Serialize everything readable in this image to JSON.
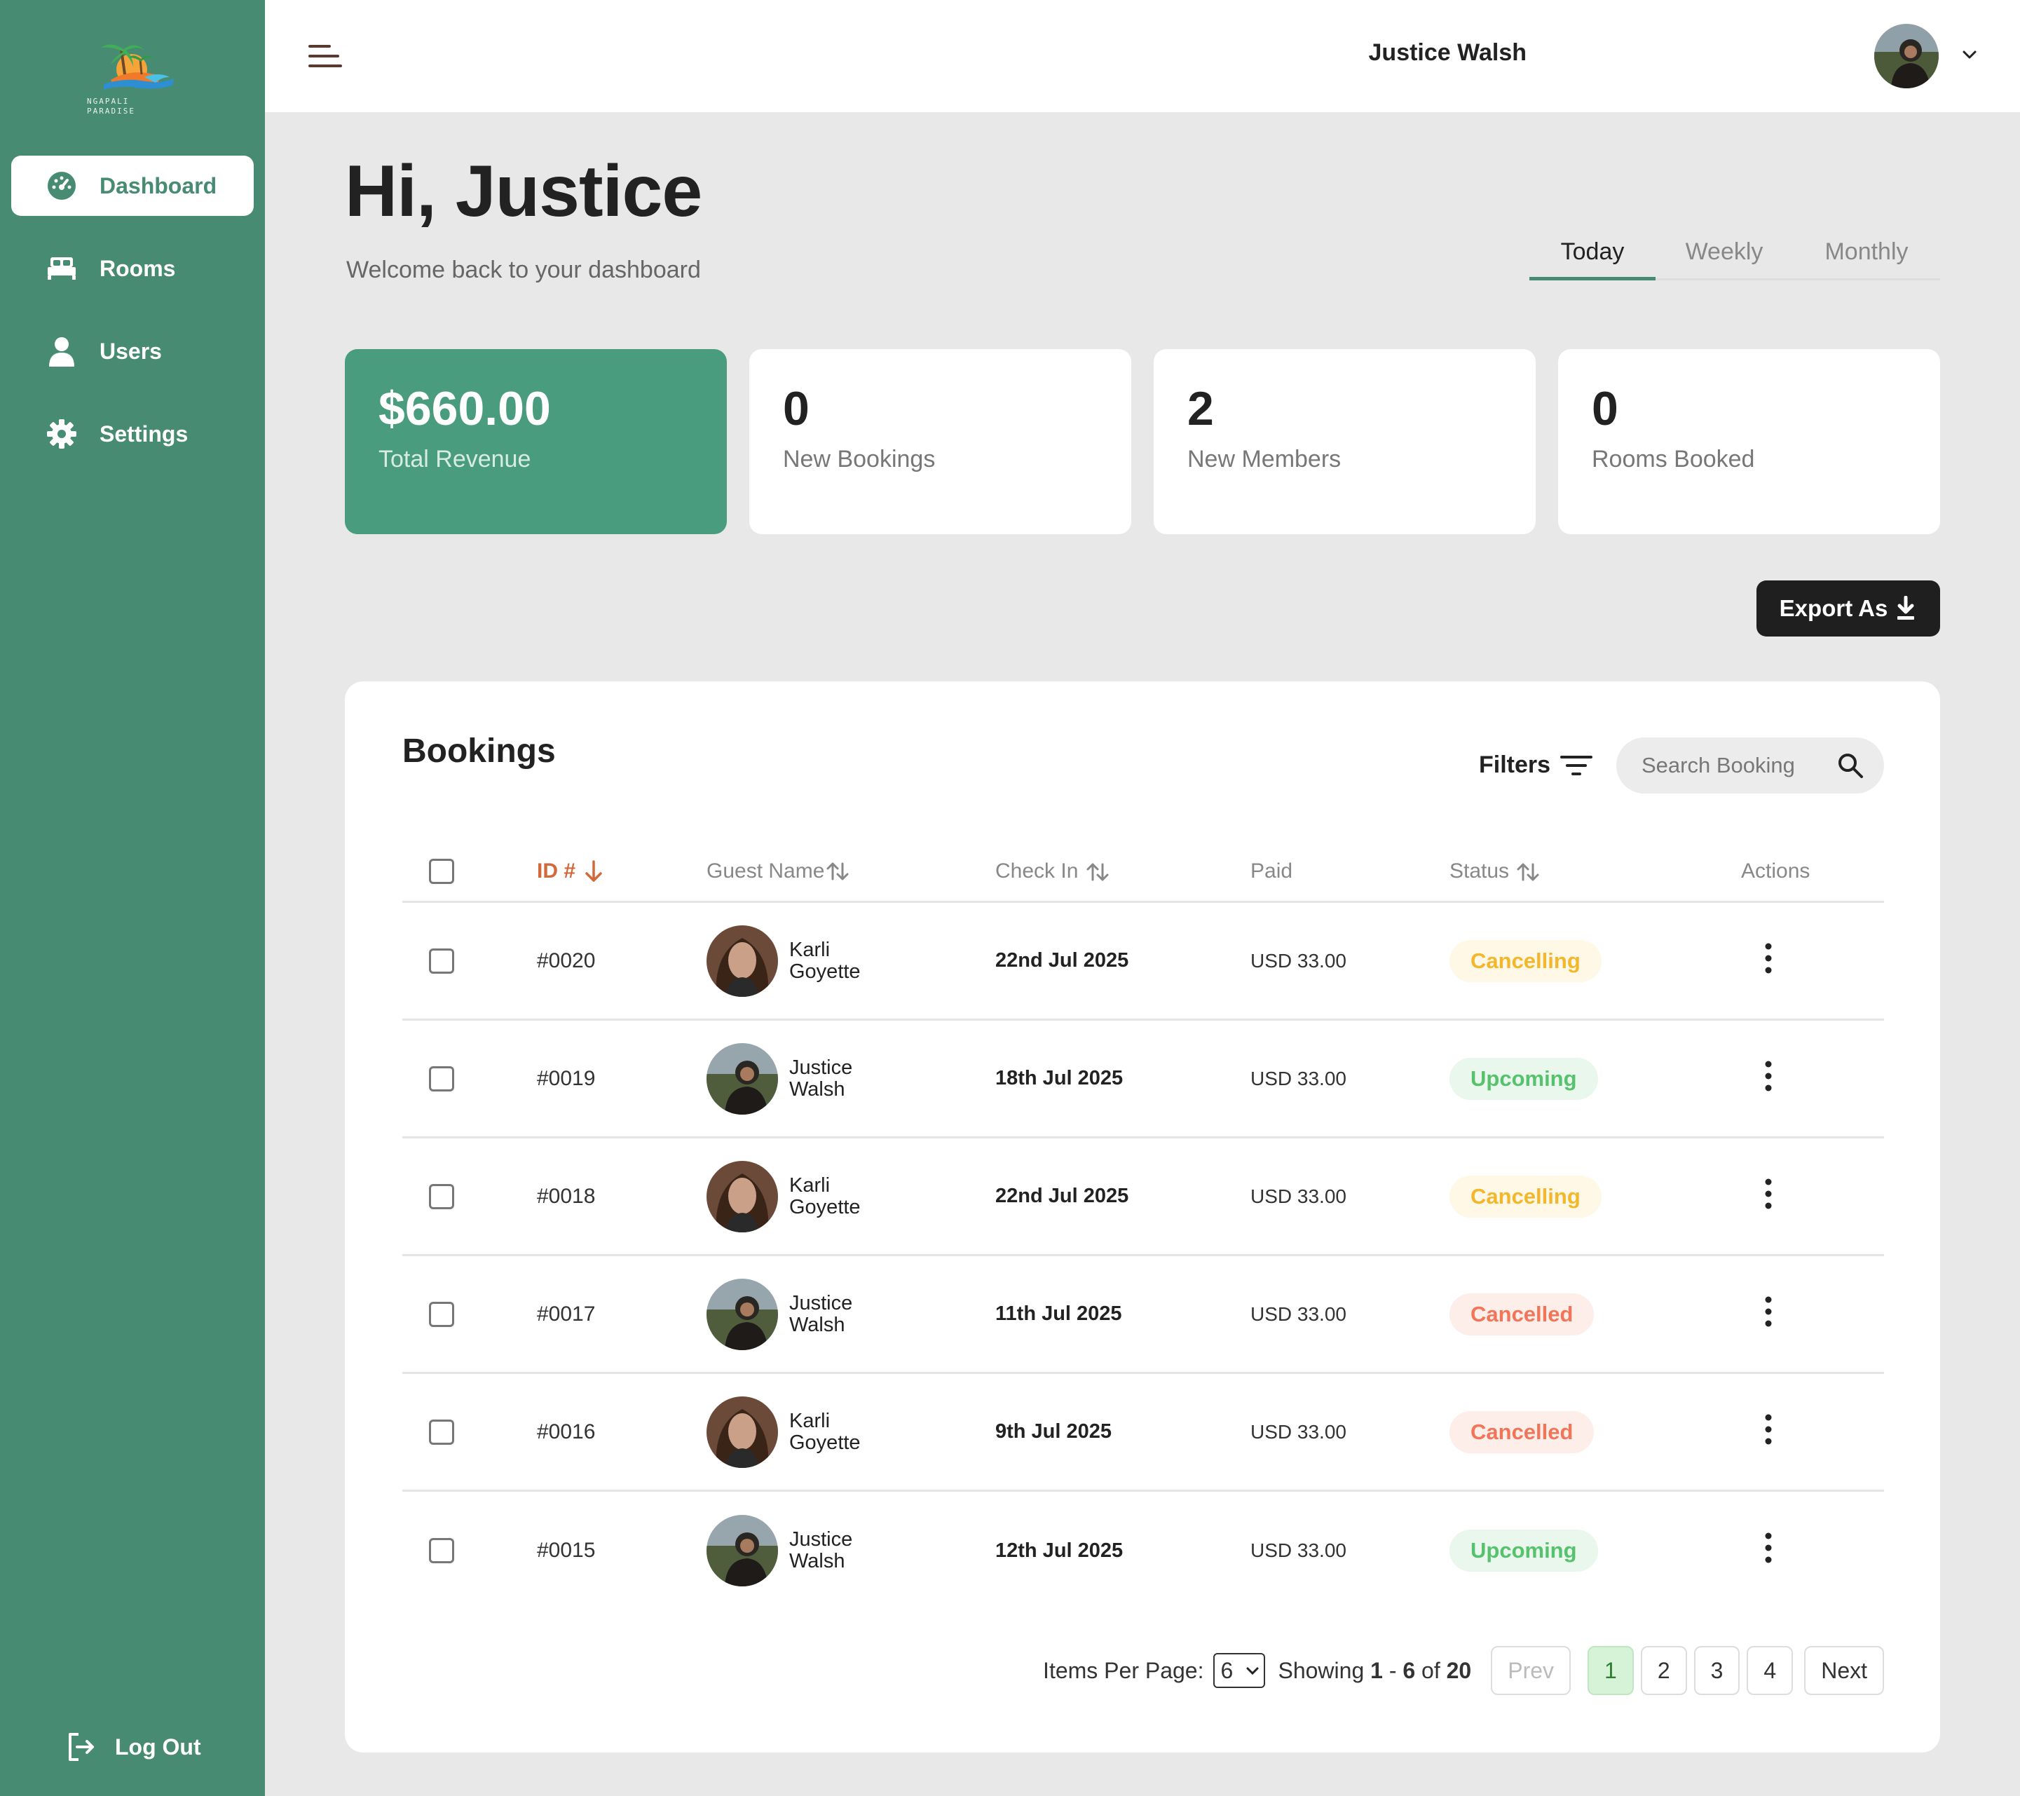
{
  "brand": {
    "logo_text_1": "NGAPALI",
    "logo_text_2": "PARADISE"
  },
  "sidebar": {
    "items": [
      {
        "label": "Dashboard",
        "icon": "gauge-icon",
        "active": true
      },
      {
        "label": "Rooms",
        "icon": "bed-icon",
        "active": false
      },
      {
        "label": "Users",
        "icon": "user-icon",
        "active": false
      },
      {
        "label": "Settings",
        "icon": "gear-icon",
        "active": false
      }
    ],
    "logout_label": "Log Out"
  },
  "topbar": {
    "user_name": "Justice Walsh"
  },
  "header": {
    "greeting": "Hi, Justice",
    "subtitle": "Welcome back to your dashboard",
    "period_tabs": [
      "Today",
      "Weekly",
      "Monthly"
    ],
    "active_period": "Today"
  },
  "stats": [
    {
      "value": "$660.00",
      "label": "Total Revenue"
    },
    {
      "value": "0",
      "label": "New Bookings"
    },
    {
      "value": "2",
      "label": "New Members"
    },
    {
      "value": "0",
      "label": "Rooms Booked"
    }
  ],
  "export_label": "Export As",
  "bookings": {
    "title": "Bookings",
    "filters_label": "Filters",
    "search_placeholder": "Search Booking",
    "columns": {
      "id": "ID #",
      "guest": "Guest Name",
      "check_in": "Check In",
      "paid": "Paid",
      "status": "Status",
      "actions": "Actions"
    },
    "rows": [
      {
        "id": "#0020",
        "guest_first": "Karli",
        "guest_last": "Goyette",
        "check_in": "22nd Jul 2025",
        "paid": "USD 33.00",
        "status": "Cancelling"
      },
      {
        "id": "#0019",
        "guest_first": "Justice",
        "guest_last": "Walsh",
        "check_in": "18th Jul 2025",
        "paid": "USD 33.00",
        "status": "Upcoming"
      },
      {
        "id": "#0018",
        "guest_first": "Karli",
        "guest_last": "Goyette",
        "check_in": "22nd Jul 2025",
        "paid": "USD 33.00",
        "status": "Cancelling"
      },
      {
        "id": "#0017",
        "guest_first": "Justice",
        "guest_last": "Walsh",
        "check_in": "11th Jul 2025",
        "paid": "USD 33.00",
        "status": "Cancelled"
      },
      {
        "id": "#0016",
        "guest_first": "Karli",
        "guest_last": "Goyette",
        "check_in": "9th Jul 2025",
        "paid": "USD 33.00",
        "status": "Cancelled"
      },
      {
        "id": "#0015",
        "guest_first": "Justice",
        "guest_last": "Walsh",
        "check_in": "12th Jul 2025",
        "paid": "USD 33.00",
        "status": "Upcoming"
      }
    ]
  },
  "pagination": {
    "items_per_page_label": "Items Per Page:",
    "items_per_page": "6",
    "showing_prefix": "Showing",
    "range_start": "1",
    "range_sep": "-",
    "range_end": "6",
    "of_label": "of",
    "total": "20",
    "prev_label": "Prev",
    "pages": [
      "1",
      "2",
      "3",
      "4"
    ],
    "current_page": "1",
    "next_label": "Next"
  },
  "colors": {
    "sidebar": "#478c72",
    "primary_card": "#4a9c7e",
    "accent_sort": "#d2693a",
    "status_cancelling": "#f3b72e",
    "status_upcoming": "#57c26e",
    "status_cancelled": "#f17659"
  }
}
